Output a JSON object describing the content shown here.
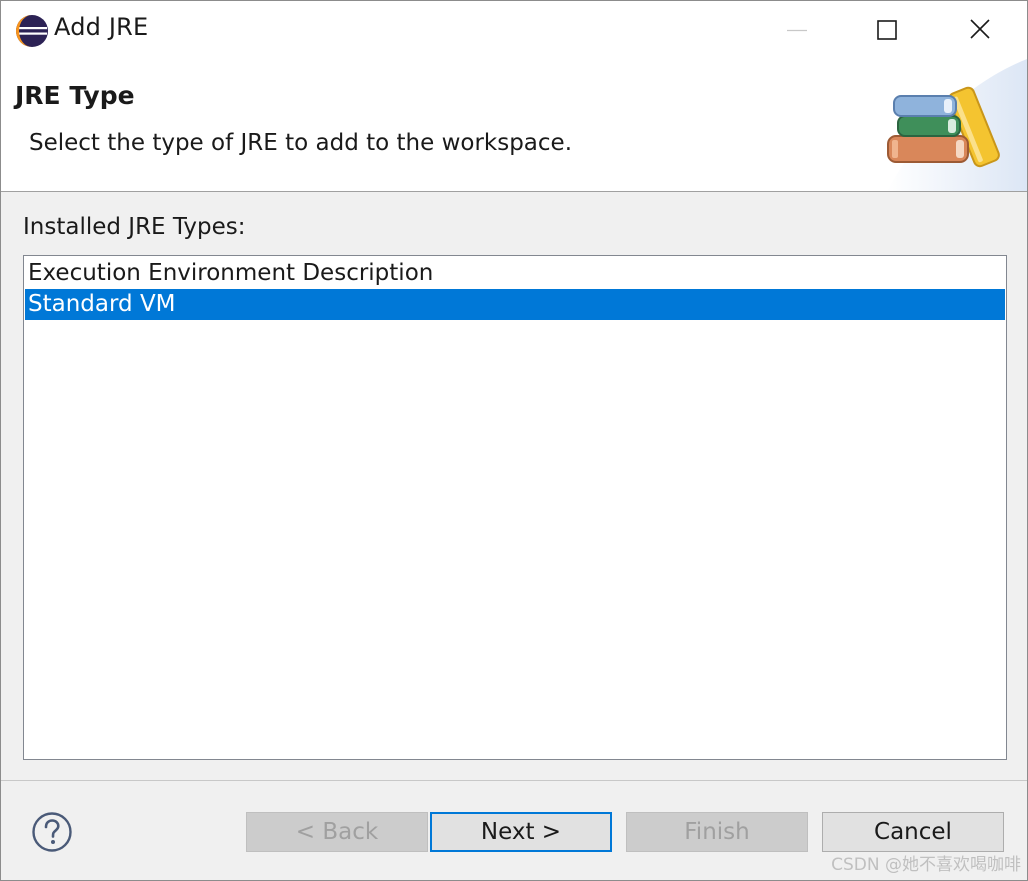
{
  "window": {
    "title": "Add JRE"
  },
  "banner": {
    "title": "JRE Type",
    "description": "Select the type of JRE to add to the workspace."
  },
  "list": {
    "label": "Installed JRE Types:",
    "items": [
      {
        "label": "Execution Environment Description",
        "selected": false
      },
      {
        "label": "Standard VM",
        "selected": true
      }
    ]
  },
  "buttons": {
    "back": "< Back",
    "next": "Next >",
    "finish": "Finish",
    "cancel": "Cancel"
  },
  "watermark": "CSDN @她不喜欢喝咖啡",
  "colors": {
    "selection": "#0078d7",
    "default_button_border": "#0078d7"
  }
}
